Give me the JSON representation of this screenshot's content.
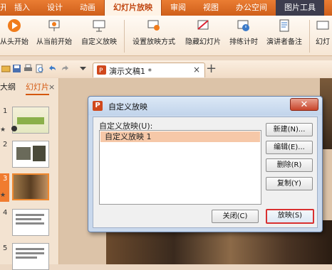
{
  "menu": {
    "tabs": [
      "开始",
      "插入",
      "设计",
      "动画",
      "幻灯片放映",
      "审阅",
      "视图",
      "办公空间",
      "图片工具"
    ],
    "active": "幻灯片放映"
  },
  "ribbon": {
    "buttons": [
      "从头开始",
      "从当前开始",
      "自定义放映",
      "设置放映方式",
      "隐藏幻灯片",
      "排练计时",
      "演讲者备注",
      "幻灯"
    ]
  },
  "toolbar": {
    "doc_tab": "演示文稿1 *",
    "close_glyph": "×",
    "new_tab_glyph": "+"
  },
  "side_panel": {
    "tab_outline": "大纲",
    "tab_slides": "幻灯片",
    "close_glyph": "×",
    "slide_numbers": [
      "1",
      "2",
      "3",
      "4",
      "5"
    ]
  },
  "dialog": {
    "title": "自定义放映",
    "logo": "P",
    "close_glyph": "✕",
    "list_label": "自定义放映(U):",
    "list_items": [
      "自定义放映 1"
    ],
    "buttons": {
      "new": "新建(N)...",
      "edit": "编辑(E)...",
      "delete": "删除(R)",
      "copy": "复制(Y)",
      "close": "关闭(C)",
      "show": "放映(S)"
    }
  },
  "colors": {
    "accent_orange": "#d4580f",
    "menu_bar": "#e0702a",
    "dialog_frame": "#c9d8ec",
    "list_selection": "#f6c8a8",
    "close_button": "#c8442a"
  }
}
